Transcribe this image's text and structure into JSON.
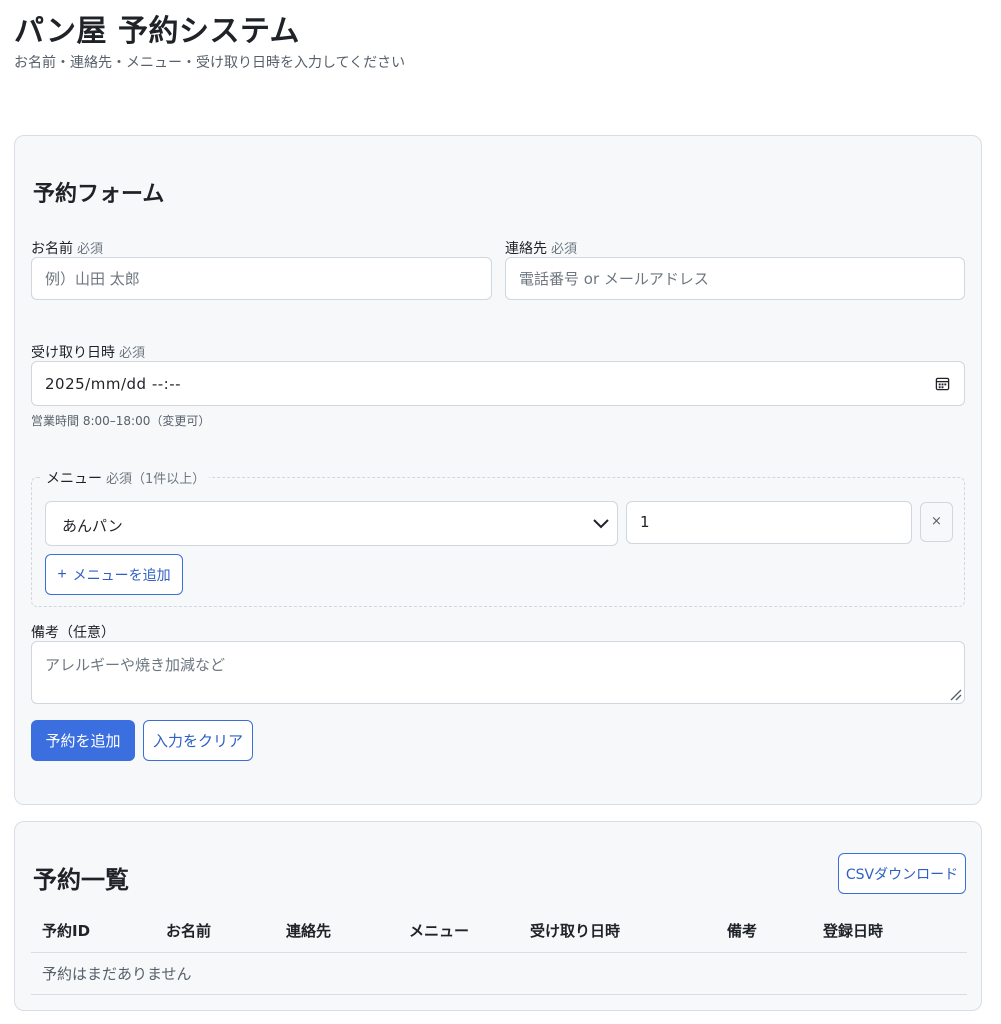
{
  "header": {
    "title": "パン屋 予約システム",
    "subtitle": "お名前・連絡先・メニュー・受け取り日時を入力してください"
  },
  "form": {
    "title": "予約フォーム",
    "name": {
      "label": "お名前",
      "required": "必須",
      "placeholder": "例）山田 太郎",
      "value": ""
    },
    "contact": {
      "label": "連絡先",
      "required": "必須",
      "placeholder": "電話番号 or メールアドレス",
      "value": ""
    },
    "pickup": {
      "label": "受け取り日時",
      "required": "必須",
      "value": "2025/mm/dd --:--",
      "hint": "営業時間 8:00–18:00（変更可）",
      "icon": "calendar-icon"
    },
    "menu": {
      "legend": "メニュー",
      "required": "必須（1件以上）",
      "item": {
        "selected": "あんパン",
        "quantity": "1",
        "remove": "×"
      },
      "add_label": "メニューを追加",
      "add_icon": "+"
    },
    "notes": {
      "label": "備考（任意）",
      "placeholder": "アレルギーや焼き加減など"
    },
    "submit_label": "予約を追加",
    "clear_label": "入力をクリア"
  },
  "list": {
    "title": "予約一覧",
    "csv_label": "CSVダウンロード",
    "columns": [
      "予約ID",
      "お名前",
      "連絡先",
      "メニュー",
      "受け取り日時",
      "備考",
      "登録日時"
    ],
    "empty_message": "予約はまだありません"
  },
  "colors": {
    "accent": "#3b6fe0",
    "accent_text": "#2f5fc4",
    "card_bg": "#f6f8fa",
    "border": "#d0d7de"
  }
}
